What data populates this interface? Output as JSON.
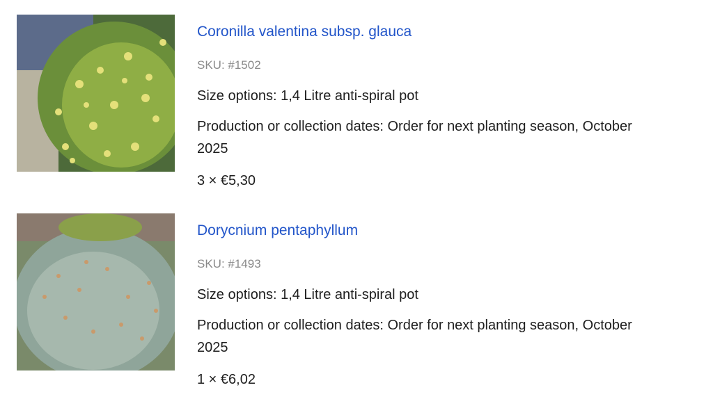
{
  "items": [
    {
      "image_alt": "Coronilla valentina subsp. glauca plant with yellow flowers",
      "title": "Coronilla valentina subsp. glauca",
      "sku": "SKU: #1502",
      "size": "Size options: 1,4 Litre anti-spiral pot",
      "dates": "Production or collection dates: Order for next planting season, October 2025",
      "price": "3 × €5,30"
    },
    {
      "image_alt": "Dorycnium pentaphyllum shrub with grey-green foliage",
      "title": "Dorycnium pentaphyllum",
      "sku": "SKU: #1493",
      "size": "Size options: 1,4 Litre anti-spiral pot",
      "dates": "Production or collection dates: Order for next planting season, October 2025",
      "price": "1 × €6,02"
    }
  ],
  "colors": {
    "link": "#2255c9",
    "sku": "#8a8a8a",
    "text": "#1e1e1e"
  }
}
